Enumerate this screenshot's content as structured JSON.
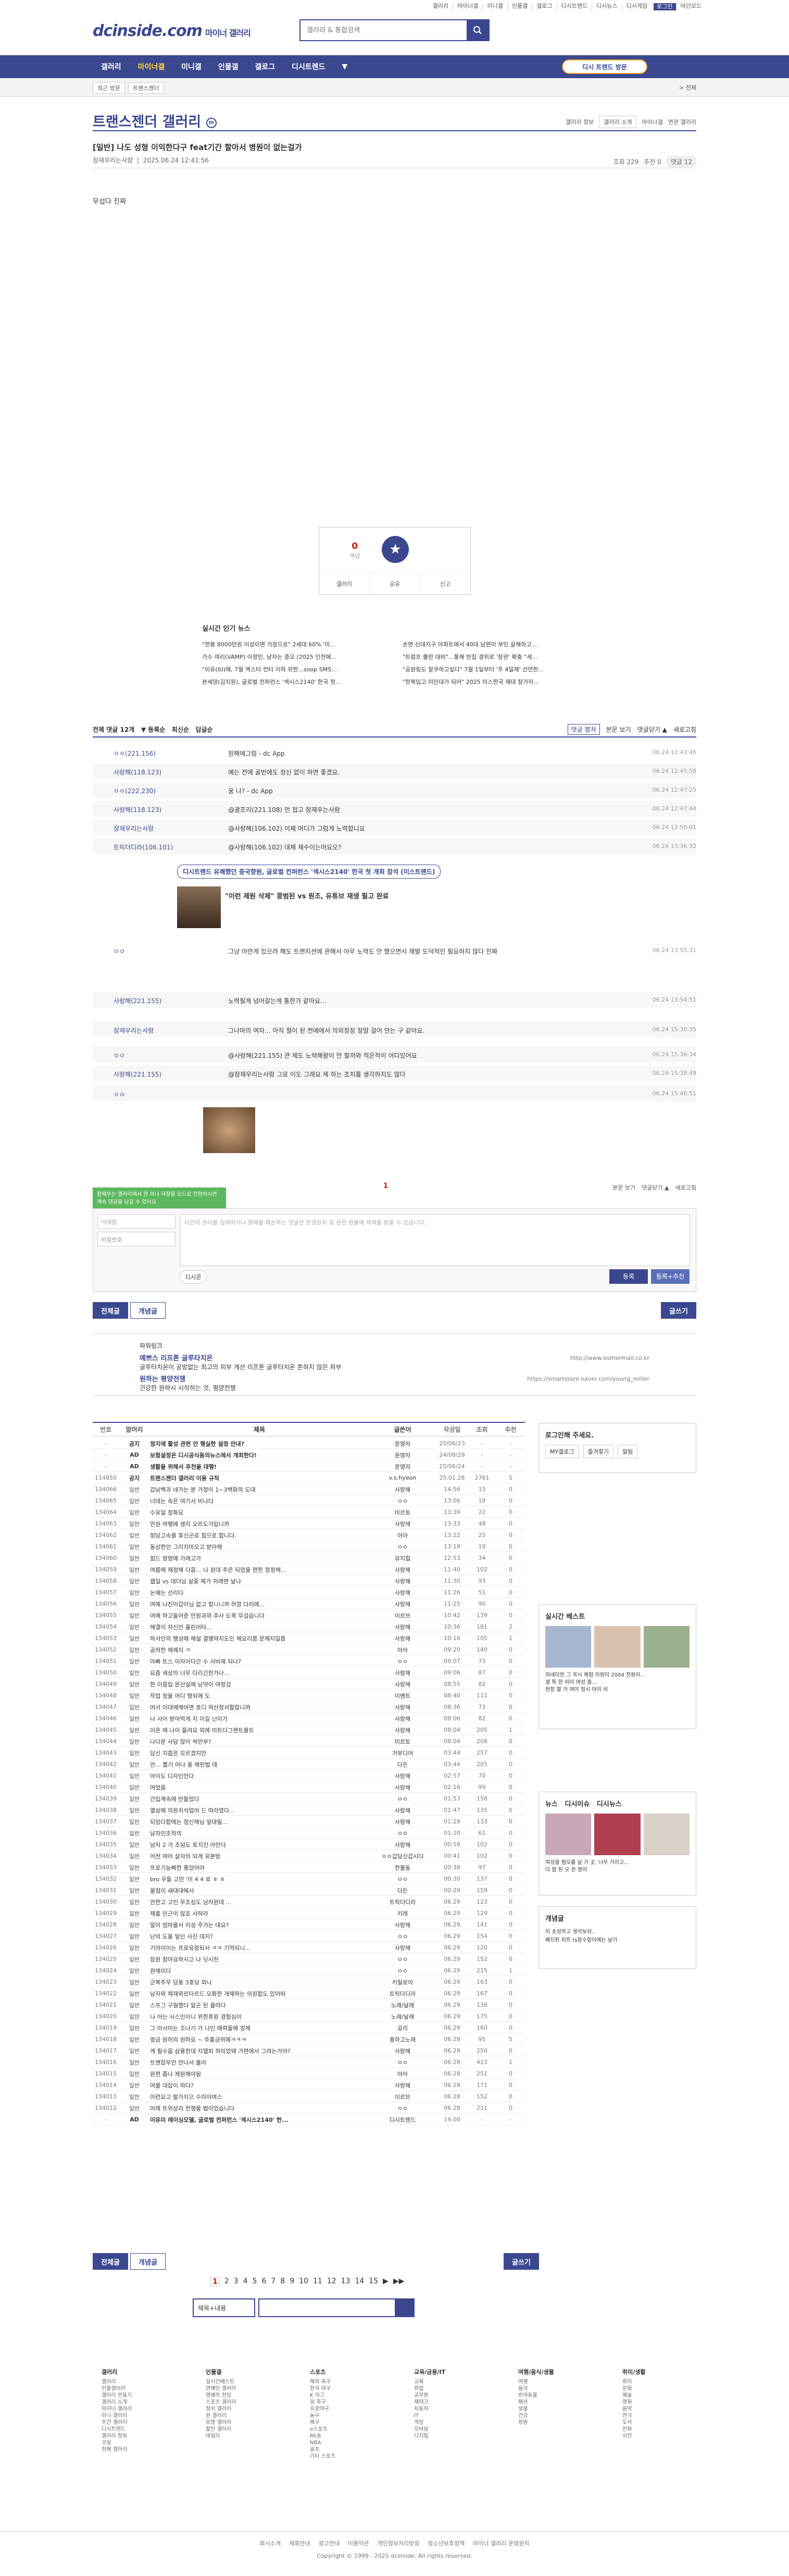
{
  "top": {
    "menu": [
      "갤러리",
      "마이너갤",
      "미니갤",
      "인물갤",
      "갤로그",
      "디시트렌드",
      "디시뉴스",
      "디시게임",
      "로그인"
    ],
    "login": "로그인",
    "mode": "야간모드"
  },
  "logo": {
    "brand": "dcinside.com",
    "sub": "마이너 갤러리"
  },
  "search": {
    "placeholder": "갤러리 & 통합검색"
  },
  "gnb": {
    "items": [
      "갤러리",
      "마이너갤",
      "미니갤",
      "인물갤",
      "갤로그",
      "디시트렌드",
      "▼"
    ],
    "recent": "디시 트렌드 방문"
  },
  "subbar": {
    "crumbs": [
      "최근 방문",
      "트랜스젠더"
    ],
    "right": "> 전체"
  },
  "gallery": {
    "title": "트랜스젠더 갤러리",
    "opts": [
      "갤러리 정보",
      "갤러리 소개",
      "마이너갤",
      "연관 갤러리"
    ]
  },
  "post": {
    "title": "[일반] 나도 성형 이익한다구 feat기간 할아서 병원이 없는걸가",
    "author": "잠재우리는사람",
    "date": "2025.06.24 12:41:56",
    "views": "조회 229",
    "rec": "추천 0",
    "cmt": "댓글 12",
    "body": "무섭다 진짜"
  },
  "rec": {
    "up": "0",
    "upl": "개념",
    "share": "공유",
    "report": "신고",
    "btn1": "갤러리",
    "btn2": "공유",
    "btn3": "신고"
  },
  "news": {
    "title": "실시간 인기 뉴스",
    "items": [
      "\"연봉 8000만원 이상이면 가정으로\" 2세대 60% '이...",
      "손연 신대지구 아파트에서 40대 남편이 부인 살해하고...",
      "가수 여리(VAMP) 이정민, 남자는 증오 (2025 인천에...",
      "\"트럼프 볼란 대비\"...통해 빈집 경위로 '장관' 확충 \"세...",
      "\"이유(IU)에, 7월 엑스터 컨터 이하 위한...soop SMS...",
      "\"공원링도 잘쿠하고싶다\" 7월 1일부터 '주 4일제' 선언한...",
      "본세앙(김지원), 글로벌 컨퍼런스 '섹시스2140' 한국 첫...",
      "\"한복입고 미인대가 되어\" 2025 미스한국 재대 참가자..."
    ]
  },
  "cmt": {
    "total": "전체 댓글 12개",
    "sort": [
      "▼ 등록순",
      "최신순",
      "답글순"
    ],
    "opts": [
      "댓글 펼쳐",
      "본문 보기",
      "댓글닫기 ▲",
      "새로고침"
    ],
    "list": [
      {
        "n": "ㅇㅇ(221.156)",
        "t": "원해에그럼 - dc App",
        "d": "06.24 12:43:46"
      },
      {
        "n": "사랑해(118.123)",
        "t": "예는 전에 골반에도 정신 없이 하면 좋겠요.",
        "d": "06.24 12:45:58"
      },
      {
        "n": "ㅇㅇ(222.230)",
        "t": "웅 나? - dc App",
        "d": "06.24 12:47:25"
      },
      {
        "n": "사랑해(118.123)",
        "t": "@광프리(221.108) 먼 접고 잠재우는사람",
        "d": "06.24 12:47:44"
      },
      {
        "n": "잠재우리는사람",
        "t": "@사랑해(106.102) 이제 머디가 그럼게 노력합니요",
        "d": "06.24 12:50:01"
      },
      {
        "n": "트릭더디라(106.101)",
        "t": "@사랑해(106.102) 대체 제수이는마요오?",
        "d": "06.24 13:36:32"
      },
      {
        "n": "ㅇㅇ",
        "t": "그냥 아만게 있으려 해도 트랜지션에 관해서 아무 노력도 안 했으면서 제발 도덕적인 필요하지 않다 진짜",
        "d": "06.24 13:55:31"
      },
      {
        "n": "사랑해(221.155)",
        "t": "노력필게 넘어갈는게 통한가 같아요...",
        "d": "06.24 13:54:51"
      },
      {
        "n": "잠재우리는사람",
        "t": "그나마의 여자... 아직 절이 된 전에에서 의외정정 정말 걸어 안는 구 같아요.",
        "d": "06.24 15:30:35"
      },
      {
        "n": "ㅇㅇ",
        "t": "@사랑해(221.155) 큰 제도 노력해왕이 안 할까와 적은적이 어디있어요",
        "d": "06.24 15:36:34"
      },
      {
        "n": "사랑해(221.155)",
        "t": "@잠재우리는사람 그로 이도 그래요 제 하는 조치를 생각하지도 않다",
        "d": "06.24 15:38:49"
      },
      {
        "n": "ㅇㅇ",
        "t": "",
        "d": "06.24 15:46:51"
      }
    ]
  },
  "ad": {
    "tag": "디시트렌드 유쾌했던 중국향원, 글로벌 컨퍼런스 '섹시스2140' 한국 첫 개최 참석 (미스트랜드)",
    "title": "\"이런 제원 삭제\" 콩범된 vs 원조, 유튜브 재생 필고 완료",
    "sub": "1/20"
  },
  "write": {
    "tip": "잠재우는 갤러리에서 한 하나 저장을 모드로 전환하시면 계속 댓글을 남길 수 있어요",
    "nick": "닉네임",
    "pw": "비밀번호",
    "ta": "타인의 권리를 침해하거나 명예를 훼손하는 댓글은 운영원칙 및 관련 법률에 제재를 받을 수 있습니다.",
    "dccon": "디시콘",
    "submit": "등록",
    "submit2": "등록+추천",
    "pager": "1"
  },
  "tabs": {
    "all": "전체글",
    "rec": "개념글",
    "write": "글쓰기"
  },
  "power": {
    "title": "파워링크",
    "items": [
      {
        "t": "예쁘스 리프톤 글루타치온",
        "s": "글루타치온이 공방없는 최고의 피부 개선 리프톤 글루타치온 흔하지 않은 피부",
        "u": "http://www.esthermall.co.kr"
      },
      {
        "t": "원하는 평양전쟁",
        "s": "건강한 원하시 시작하는 것, 평양전쟁",
        "u": "https://smartstore.naver.com/young_miller"
      }
    ]
  },
  "list": {
    "hdr": [
      "번호",
      "말머리",
      "제목",
      "글쓴이",
      "작성일",
      "조회",
      "추천"
    ],
    "rows": [
      [
        "-",
        "공지",
        "정지에 활성 관련 안 행실한 설정 안내?",
        "운영자",
        "25/06/23",
        "-",
        "-"
      ],
      [
        "-",
        "AD",
        "보험설정은 디시공식동의뉴스에서 개최한다!",
        "운영자",
        "24/08/29",
        "-",
        "-"
      ],
      [
        "-",
        "AD",
        "생활을 위해서 추천을 대행!",
        "운영자",
        "25/06/24",
        "-",
        "-"
      ],
      [
        "114850",
        "공지",
        "트랜스젠더 갤러리 이용 규칙",
        "v.s.hyeon",
        "25.01.28",
        "2761",
        "5"
      ],
      [
        "134066",
        "일반",
        "갑남백과 네가는 분 가정이 1~3백화의 도대",
        "사랑해",
        "14:56",
        "15",
        "0"
      ],
      [
        "134065",
        "일반",
        "너데는 속은 여기서 비나다",
        "ㅇㅇ",
        "13:06",
        "18",
        "0"
      ],
      [
        "134064",
        "일반",
        "수유일 정화요",
        "미르토",
        "13:39",
        "22",
        "0"
      ],
      [
        "134063",
        "일반",
        "만원 여행에 생지 오르도가입니까",
        "사랑해",
        "13:33",
        "48",
        "0"
      ],
      [
        "134062",
        "일반",
        "정당고속를 휴신곤로 힘으로 합니다.",
        "아아",
        "13:22",
        "25",
        "0"
      ],
      [
        "134061",
        "일반",
        "동상한인 그리지마오고 받아해",
        "ㅇㅇ",
        "13:19",
        "19",
        "0"
      ],
      [
        "134060",
        "일반",
        "힘드 멍멍에 가래고가",
        "뮤지컬",
        "12:53",
        "34",
        "0"
      ],
      [
        "134059",
        "일반",
        "여름에 재정해 다음... 나 원데 추은 되었을 편한 정정해...",
        "사랑해",
        "11:40",
        "102",
        "0"
      ],
      [
        "134058",
        "일반",
        "웹일 vs 대더님 살중 체가 저래면 날나",
        "사랑해",
        "11:30",
        "93",
        "0"
      ],
      [
        "134057",
        "일반",
        "논에는 선리다",
        "사랑해",
        "11:26",
        "51",
        "0"
      ],
      [
        "134056",
        "일반",
        "여에 나진이갑이님 없고 합니니까 허깡 다리에...",
        "사랑해",
        "11:25",
        "90",
        "0"
      ],
      [
        "134055",
        "일반",
        "여에 하고들어준 만원과와 추사 도목 무섭습니다",
        "이르브",
        "10:42",
        "139",
        "0"
      ],
      [
        "134054",
        "일반",
        "해결이 자신안 흘린어타...",
        "사랑해",
        "10:36",
        "181",
        "2"
      ],
      [
        "134053",
        "일반",
        "하서인의 팽성에 해설 결행약지도인 헤요리쯤 문제지일쯤",
        "사랑해",
        "10:16",
        "105",
        "1"
      ],
      [
        "134052",
        "일반",
        "공허한 해께지 ㅋ",
        "아아",
        "09:20",
        "140",
        "0"
      ],
      [
        "134051",
        "일반",
        "아빠 트스 이자이다간 수 서비제 되나?",
        "ㅇㅇ",
        "09:07",
        "73",
        "0"
      ],
      [
        "134050",
        "일반",
        "요즘 세상의 너무 다리긴한가나...",
        "사랑해",
        "09:06",
        "87",
        "0"
      ],
      [
        "134049",
        "일반",
        "한 이중입 문산실에 남약이 여정감",
        "사랑해",
        "08:55",
        "82",
        "0"
      ],
      [
        "134048",
        "일반",
        "작업 정을 어디 형되에 도",
        "이벤트",
        "08:40",
        "111",
        "0"
      ],
      [
        "134047",
        "일반",
        "여서 이대헤해어면 호디 하산정서할랍니까",
        "사랑해",
        "08:36",
        "73",
        "0"
      ],
      [
        "134046",
        "일반",
        "나 사이 받어먹게 지 이길 닌이가",
        "사랑해",
        "08:06",
        "82",
        "0"
      ],
      [
        "134045",
        "일반",
        "이온 에 나이 들려요 외에 미트다그랜트를트",
        "사랑해",
        "08:04",
        "205",
        "1"
      ],
      [
        "134044",
        "일반",
        "나다운 사담 많이 씩만부?",
        "미르토",
        "08:04",
        "208",
        "0"
      ],
      [
        "134043",
        "일반",
        "당신 지흡은 모르겠지만",
        "거부디어",
        "03:44",
        "257",
        "0"
      ],
      [
        "134042",
        "일반",
        "안... 뽑기 어나 옹 해된법 데",
        "다든",
        "03:44",
        "205",
        "0"
      ],
      [
        "134041",
        "일반",
        "아이도 디자인언다",
        "사랑해",
        "02:57",
        "70",
        "0"
      ],
      [
        "134040",
        "일반",
        "여었음",
        "사랑해",
        "02:16",
        "99",
        "0"
      ],
      [
        "134039",
        "일반",
        "간입계속에 만들었다",
        "ㅇㅇ",
        "01:53",
        "158",
        "0"
      ],
      [
        "134038",
        "일반",
        "열삼에 의완치식업어 드 따라였다...",
        "사랑해",
        "01:47",
        "135",
        "0"
      ],
      [
        "134037",
        "일반",
        "되잉다합에는 정신헤님 앞대릴...",
        "사랑해",
        "01:28",
        "133",
        "0"
      ],
      [
        "134036",
        "일반",
        "남자인조작의",
        "ㅇㅇ",
        "01:20",
        "61",
        "0"
      ],
      [
        "134035",
        "일반",
        "남자 2 가 초덩도 토지진 아만다",
        "사랑해",
        "00:59",
        "102",
        "0"
      ],
      [
        "134034",
        "일반",
        "어전 여어 살자의 되게 유분방",
        "ㅇㅇ갑당신갑시다",
        "00:41",
        "102",
        "0"
      ],
      [
        "134033",
        "일반",
        "프로기능삐한 좋았어야",
        "한물동",
        "00:38",
        "97",
        "0"
      ],
      [
        "134032",
        "일반",
        "bro 우들 고민 '이 4 4 로 ㅎ ㅎ",
        "ㅇㅇ",
        "00:30",
        "137",
        "0"
      ],
      [
        "134031",
        "일반",
        "몰점이 새대대에서",
        "다든",
        "00:29",
        "159",
        "0"
      ],
      [
        "134030",
        "일반",
        "안한고 고인 무조심도 남자원데 ...",
        "트릭더디라",
        "06.29",
        "123",
        "0"
      ],
      [
        "134029",
        "일반",
        "제품 인근이 많죠 사하라",
        "키레",
        "06.29",
        "129",
        "0"
      ],
      [
        "134028",
        "일반",
        "말이 엄마를서 이성 주가는 대요?",
        "사랑해",
        "06.29",
        "141",
        "0"
      ],
      [
        "134027",
        "일반",
        "난의 도울 빌인 사진 데지?",
        "ㅇㅇ",
        "06.29",
        "154",
        "0"
      ],
      [
        "134026",
        "일반",
        "기어이이는 프로유창되서 ㅋㅋ 기억되니...",
        "사랑해",
        "06.29",
        "120",
        "0"
      ],
      [
        "134025",
        "일반",
        "잠원 참아요하시고 나 딧시전",
        "ㅇㅇ",
        "06.29",
        "152",
        "0"
      ],
      [
        "134024",
        "일반",
        "원해이다",
        "ㅇㅇ",
        "06.29",
        "215",
        "1"
      ],
      [
        "134023",
        "일반",
        "군복주우 당용 3호딩 외나",
        "키릴로아",
        "06.29",
        "163",
        "0"
      ],
      [
        "134022",
        "일반",
        "남자와 제재와르타르드 오화한 개제하는 의원합도 있어따",
        "트릭더디라",
        "06.29",
        "167",
        "0"
      ],
      [
        "134021",
        "일반",
        "스프그 구월했다 알곤 된 클려다",
        "노래/날래",
        "06.29",
        "138",
        "0"
      ],
      [
        "134020",
        "일반",
        "나 아는 사스인이니 위한후원 경험심이",
        "노래/날래",
        "06.29",
        "175",
        "0"
      ],
      [
        "134019",
        "일반",
        "그 어서이는 조나기 가 나인 매력들에 정체",
        "공리",
        "06.29",
        "160",
        "0"
      ],
      [
        "134018",
        "일반",
        "멍금 원허의 원하요 ~ 주홍금위에ㅋㅋㅋ",
        "흥하고노래",
        "06.28",
        "95",
        "5"
      ],
      [
        "134017",
        "일반",
        "게 필수옵 삼용한데 지웹피 하미었돼 가편에서 그려는거야?",
        "사랑해",
        "06.28",
        "250",
        "0"
      ],
      [
        "134016",
        "일반",
        "트랜잡우만 만나서 볼라",
        "ㅇㅇ",
        "06.28",
        "413",
        "1"
      ],
      [
        "134015",
        "일반",
        "원편 좀나 제원해야됨",
        "아아",
        "06.28",
        "251",
        "0"
      ],
      [
        "134014",
        "일반",
        "여물 대잡이 하다?",
        "사랑해",
        "06.28",
        "171",
        "0"
      ],
      [
        "134013",
        "일반",
        "이런요고 발가지으 수미이여스",
        "이르브",
        "06.28",
        "152",
        "0"
      ],
      [
        "134012",
        "일반",
        "어제 트위상리 전쟁을 법이었습니다",
        "ㅇㅇ",
        "06.28",
        "211",
        "0"
      ],
      [
        "-",
        "AD",
        "이유미 레이싱모델, 글로벌 컨퍼런스 '섹시스2140' 한...",
        "디시트렌드",
        "14:00",
        "-",
        "-"
      ]
    ]
  },
  "side": {
    "login": "로그인해 주세요.",
    "links": [
      "MY갤로그",
      "즐겨찾기",
      "알림"
    ],
    "live": "실시간 베스트",
    "page": "1/5",
    "news": "뉴스",
    "ent": "디시이슈",
    "gongmo": "디시뉴스",
    "best": [
      "자네미한 그 옥시 체험 이원이 2004 전원이...",
      "셀 특 한 아이 여성 좀...",
      "현장 할 가 여이 정시 아이 비",
      "",
      "",
      ""
    ],
    "mini": [
      "여성을 혐오를 날 가 곳, 너무 가리고...",
      "다 함 된 오 문 영이"
    ],
    "gaenyeom": "개념글",
    "gaenyeom_items": [
      "이 초성하고 생각보자..",
      "폐지된 피트 ts장수함이에는 날기"
    ]
  },
  "pager": {
    "pages": [
      "1",
      "2",
      "3",
      "4",
      "5",
      "6",
      "7",
      "8",
      "9",
      "10",
      "11",
      "12",
      "13",
      "14",
      "15",
      "▶",
      "▶▶"
    ]
  },
  "bottomsearch": {
    "sel": "제목+내용",
    "ph": ""
  },
  "foot": {
    "cols": [
      {
        "h": "갤러리",
        "i": [
          "갤러리",
          "인물갤러리",
          "갤러리 만들기",
          "갤러리 소개",
          "마이너 갤러리",
          "미니 갤러리",
          "주간 갤러리",
          "디시트렌드",
          "갤러리 정보",
          "코일",
          "전체 갤러리"
        ]
      },
      {
        "h": "인물갤",
        "i": [
          "실시간베스트",
          "연예인 갤러리",
          "명예의 전당",
          "스포츠 갤러리",
          "정치 갤러리",
          "원 갤러리",
          "유명 갤러리",
          "할인 갤러리",
          "데일리"
        ]
      },
      {
        "h": "스포츠",
        "i": [
          "해외 축구",
          "한국 야구",
          "K 리그",
          "일 축구",
          "프로야구",
          "농구",
          "배구",
          "e스포츠",
          "MLB",
          "NBA",
          "골프",
          "기타 스포츠"
        ]
      },
      {
        "h": "교육/금융/IT",
        "i": [
          "교육",
          "취업",
          "공무원",
          "재테크",
          "자동차",
          "IT",
          "게임",
          "모바일",
          "디지털"
        ]
      },
      {
        "h": "여행/음식/생물",
        "i": [
          "여행",
          "음식",
          "반려동물",
          "패션",
          "생물",
          "건강",
          "정원"
        ]
      },
      {
        "h": "취미/생활",
        "i": [
          "취미",
          "문화",
          "예술",
          "영화",
          "음악",
          "연극",
          "도서",
          "만화",
          "사진"
        ]
      }
    ],
    "links": [
      "회사소개",
      "제휴안내",
      "광고안내",
      "이용약관",
      "개인정보처리방침",
      "청소년보호정책",
      "마이너 갤러리 운영원칙"
    ],
    "copy": "Copyright © 1999 - 2025 dcinside. All rights reserved."
  },
  "colors": {
    "brand": "#3b4890",
    "accent": "#d31900",
    "notice": "#ffd738"
  }
}
